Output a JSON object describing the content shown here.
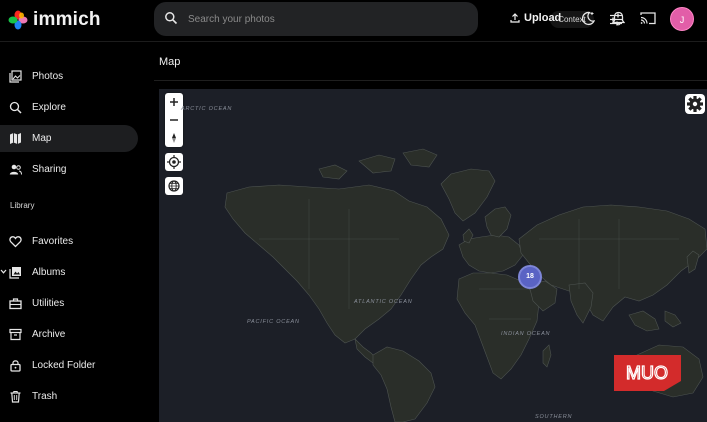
{
  "app": {
    "name": "immich",
    "colors": {
      "accent_pink": "#e25ea8",
      "cluster_blue": "#5a63c4",
      "sidebar_active": "#1d1e20",
      "watermark_red": "#d32b2b"
    }
  },
  "header": {
    "search": {
      "placeholder": "Search your photos",
      "icon": "search-icon"
    },
    "context_label": "Context",
    "upload_label": "Upload",
    "avatar_initial": "J"
  },
  "sidebar": {
    "items": [
      {
        "label": "Photos",
        "icon": "photos-icon"
      },
      {
        "label": "Explore",
        "icon": "explore-search-icon"
      },
      {
        "label": "Map",
        "icon": "map-icon",
        "active": true
      },
      {
        "label": "Sharing",
        "icon": "sharing-icon"
      }
    ],
    "library_label": "Library",
    "library_items": [
      {
        "label": "Favorites",
        "icon": "heart-icon"
      },
      {
        "label": "Albums",
        "icon": "albums-icon"
      },
      {
        "label": "Utilities",
        "icon": "toolbox-icon"
      },
      {
        "label": "Archive",
        "icon": "archive-icon"
      },
      {
        "label": "Locked Folder",
        "icon": "lock-icon"
      },
      {
        "label": "Trash",
        "icon": "trash-icon"
      }
    ]
  },
  "main": {
    "title": "Map",
    "map": {
      "oceans": {
        "arctic": "ARCTIC OCEAN",
        "atlantic": "ATLANTIC OCEAN",
        "pacific": "PACIFIC OCEAN",
        "indian": "INDIAN OCEAN",
        "southern": "SOUTHERN"
      },
      "cluster_count": "18",
      "watermark": "MUO"
    }
  }
}
